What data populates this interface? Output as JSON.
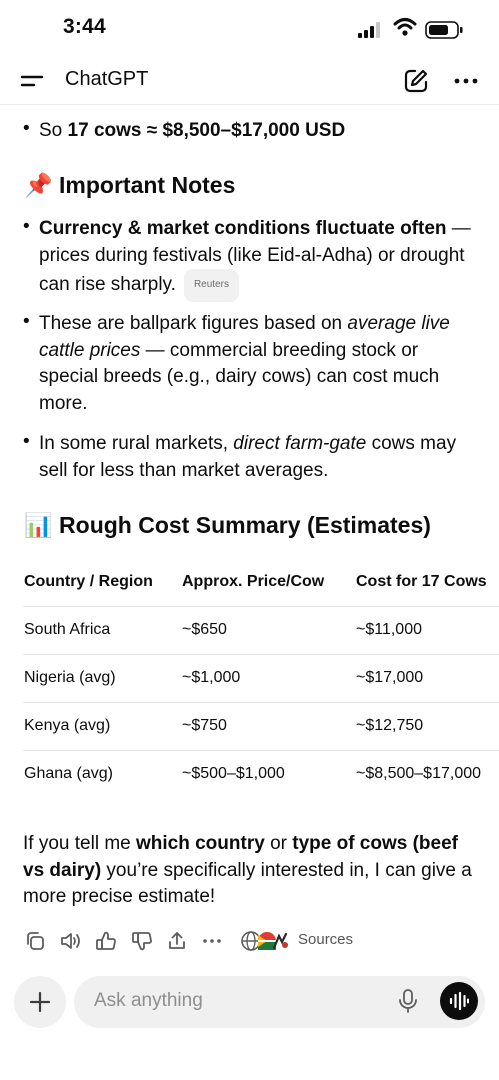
{
  "status_bar": {
    "time": "3:44"
  },
  "header": {
    "title": "ChatGPT"
  },
  "content": {
    "top_bullet": {
      "prefix": "So ",
      "bold": "17 cows ≈ $8,500–$17,000 USD"
    },
    "notes_heading": {
      "emoji": "📌",
      "text": "Important Notes"
    },
    "notes": [
      {
        "bold": "Currency & market conditions fluctuate often",
        "rest": " — prices during festivals (like Eid-al-Adha) or drought can rise sharply.",
        "chip": "Reuters"
      },
      {
        "pre": "These are ballpark figures based on ",
        "italic": "average live cattle prices",
        "post": " — commercial breeding stock or special breeds (e.g., dairy cows) can cost much more."
      },
      {
        "pre": "In some rural markets, ",
        "italic": "direct farm-gate",
        "post": " cows may sell for less than market averages."
      }
    ],
    "summary_heading": {
      "emoji": "📊",
      "text": "Rough Cost Summary (Estimates)"
    },
    "table": {
      "headers": [
        "Country / Region",
        "Approx. Price/Cow",
        "Cost for 17 Cows"
      ],
      "rows": [
        [
          "South Africa",
          "~$650",
          "~$11,000"
        ],
        [
          "Nigeria (avg)",
          "~$1,000",
          "~$17,000"
        ],
        [
          "Kenya (avg)",
          "~$750",
          "~$12,750"
        ],
        [
          "Ghana (avg)",
          "~$500–$1,000",
          "~$8,500–$17,000"
        ]
      ]
    },
    "closing": {
      "p1": "If you tell me ",
      "b1": "which country",
      "p2": " or ",
      "b2": "type of cows (beef vs dairy)",
      "p3": " you’re specifically interested in, I can give a more precise estimate!"
    }
  },
  "actions": {
    "icons": [
      "copy-icon",
      "read-aloud-icon",
      "thumbs-up-icon",
      "thumbs-down-icon",
      "share-icon",
      "more-icon"
    ],
    "sources_label": "Sources"
  },
  "composer": {
    "placeholder": "Ask anything"
  },
  "colors": {
    "text": "#0d0d0d",
    "muted": "#8e8e8e",
    "surface": "#f0f0f0",
    "accent_dark": "#0d0d0d"
  }
}
